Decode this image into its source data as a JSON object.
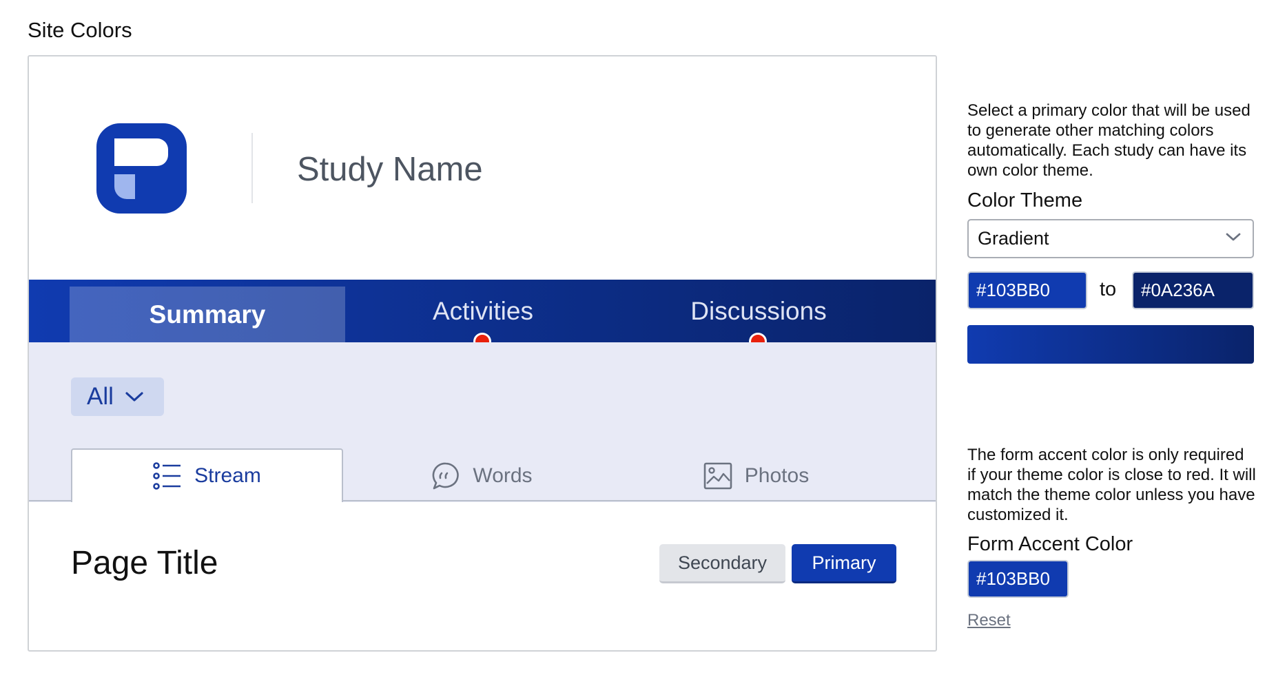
{
  "page": {
    "section_title": "Site Colors"
  },
  "preview": {
    "study_name": "Study Name",
    "nav_tabs": [
      {
        "label": "Summary",
        "active": true,
        "notification": false
      },
      {
        "label": "Activities",
        "active": false,
        "notification": true
      },
      {
        "label": "Discussions",
        "active": false,
        "notification": true
      }
    ],
    "filter": {
      "label": "All",
      "icon": "chevron-down-icon"
    },
    "content_tabs": [
      {
        "label": "Stream",
        "icon": "list-icon",
        "active": true
      },
      {
        "label": "Words",
        "icon": "speech-bubble-icon",
        "active": false
      },
      {
        "label": "Photos",
        "icon": "image-icon",
        "active": false
      }
    ],
    "page_title": "Page Title",
    "buttons": {
      "secondary": "Secondary",
      "primary": "Primary"
    }
  },
  "settings": {
    "theme_help": "Select a primary color that will be used to generate other matching colors automatically. Each study can have its own color theme.",
    "color_theme_label": "Color Theme",
    "color_theme_value": "Gradient",
    "gradient_from": "#103BB0",
    "gradient_to_word": "to",
    "gradient_to": "#0A236A",
    "accent_help": "The form accent color is only required if your theme color is close to red. It will match the theme color unless you have customized it.",
    "accent_label": "Form Accent Color",
    "accent_value": "#103BB0",
    "reset_label": "Reset"
  },
  "colors": {
    "primary": "#103BB0",
    "gradient_end": "#0A236A",
    "notification_dot": "#E8200C",
    "subarea_bg": "#E8EAF6"
  }
}
